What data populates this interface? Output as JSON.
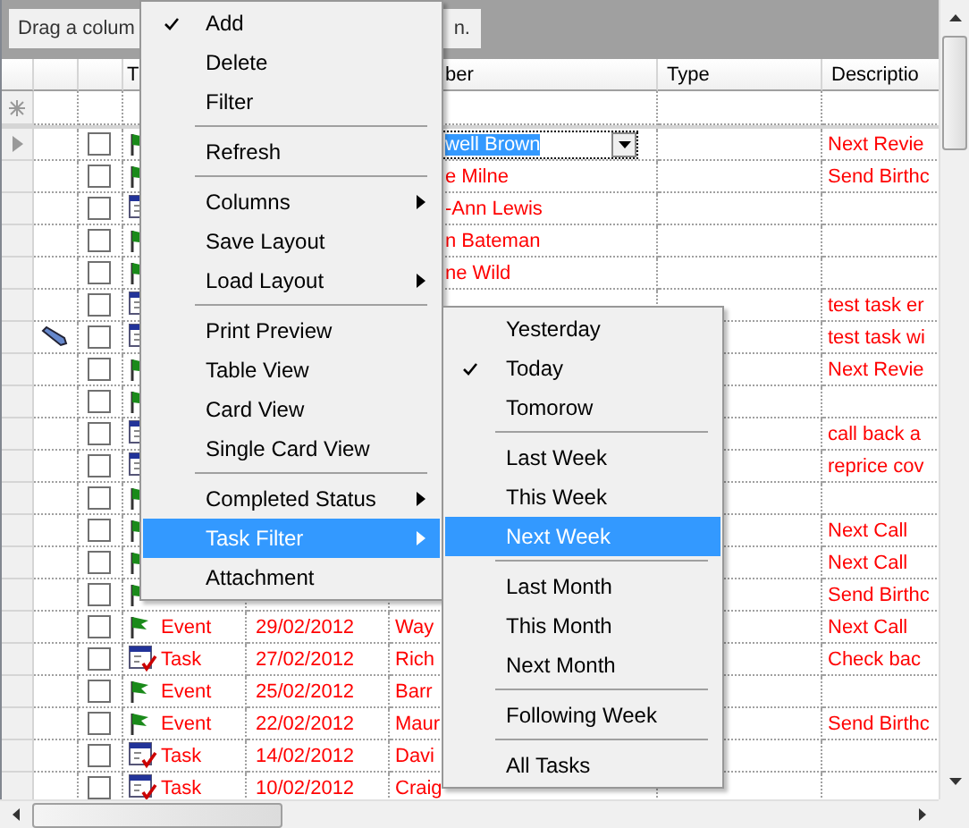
{
  "group_panel": {
    "text_left": "Drag a colum",
    "text_right": "n."
  },
  "columns": [
    {
      "label": "T"
    },
    {
      "label": "ber"
    },
    {
      "label": "Type"
    },
    {
      "label": "Descriptio"
    }
  ],
  "rows": [
    {
      "selected": true,
      "checked": false,
      "kind": "event",
      "attached": false,
      "name": "well Brown",
      "description": "Next Revie"
    },
    {
      "selected": false,
      "checked": false,
      "kind": "event",
      "attached": false,
      "name": "e Milne",
      "description": "Send Birthc"
    },
    {
      "selected": false,
      "checked": false,
      "kind": "task",
      "attached": false,
      "name": "-Ann Lewis"
    },
    {
      "selected": false,
      "checked": false,
      "kind": "event",
      "attached": false,
      "name": "n Bateman"
    },
    {
      "selected": false,
      "checked": false,
      "kind": "event",
      "attached": false,
      "name": "ne Wild"
    },
    {
      "selected": false,
      "checked": false,
      "kind": "task",
      "attached": false,
      "description": "test task er"
    },
    {
      "selected": false,
      "checked": false,
      "kind": "task",
      "attached": true,
      "description": "test task wi"
    },
    {
      "selected": false,
      "checked": false,
      "kind": "event",
      "attached": false,
      "description": "Next Revie"
    },
    {
      "selected": false,
      "checked": false,
      "kind": "event",
      "attached": false
    },
    {
      "selected": false,
      "checked": false,
      "kind": "task",
      "attached": false,
      "description": "call back a"
    },
    {
      "selected": false,
      "checked": false,
      "kind": "task",
      "attached": false,
      "description": "reprice cov"
    },
    {
      "selected": false,
      "checked": false,
      "kind": "event",
      "attached": false
    },
    {
      "selected": false,
      "checked": false,
      "kind": "event",
      "attached": false,
      "description": "Next Call"
    },
    {
      "selected": false,
      "checked": false,
      "kind": "event",
      "attached": false,
      "description": "Next Call"
    },
    {
      "selected": false,
      "checked": false,
      "kind": "event",
      "attached": false,
      "description": "Send Birthc"
    },
    {
      "selected": false,
      "checked": false,
      "kind": "event",
      "attached": false,
      "type": "Event",
      "date": "29/02/2012",
      "name": "Way",
      "description": "Next Call"
    },
    {
      "selected": false,
      "checked": false,
      "kind": "task",
      "attached": false,
      "type": "Task",
      "date": "27/02/2012",
      "name": "Rich",
      "description": "Check bac"
    },
    {
      "selected": false,
      "checked": false,
      "kind": "event",
      "attached": false,
      "type": "Event",
      "date": "25/02/2012",
      "name": "Barr"
    },
    {
      "selected": false,
      "checked": false,
      "kind": "event",
      "attached": false,
      "type": "Event",
      "date": "22/02/2012",
      "name": "Maur",
      "description": "Send Birthc"
    },
    {
      "selected": false,
      "checked": false,
      "kind": "task",
      "attached": false,
      "type": "Task",
      "date": "14/02/2012",
      "name": "Davi"
    },
    {
      "selected": false,
      "checked": false,
      "kind": "task",
      "attached": false,
      "type": "Task",
      "date": "10/02/2012",
      "name": "Craig"
    }
  ],
  "context_menu": [
    {
      "kind": "item",
      "label": "Add",
      "checked": true,
      "selected": false,
      "submenu": false
    },
    {
      "kind": "item",
      "label": "Delete",
      "checked": false,
      "selected": false,
      "submenu": false
    },
    {
      "kind": "item",
      "label": "Filter",
      "checked": false,
      "selected": false,
      "submenu": false
    },
    {
      "kind": "separator"
    },
    {
      "kind": "item",
      "label": "Refresh",
      "checked": false,
      "selected": false,
      "submenu": false
    },
    {
      "kind": "separator"
    },
    {
      "kind": "item",
      "label": "Columns",
      "checked": false,
      "selected": false,
      "submenu": true
    },
    {
      "kind": "item",
      "label": "Save Layout",
      "checked": false,
      "selected": false,
      "submenu": false
    },
    {
      "kind": "item",
      "label": "Load Layout",
      "checked": false,
      "selected": false,
      "submenu": true
    },
    {
      "kind": "separator"
    },
    {
      "kind": "item",
      "label": "Print Preview",
      "checked": false,
      "selected": false,
      "submenu": false
    },
    {
      "kind": "item",
      "label": "Table View",
      "checked": false,
      "selected": false,
      "submenu": false
    },
    {
      "kind": "item",
      "label": "Card View",
      "checked": false,
      "selected": false,
      "submenu": false
    },
    {
      "kind": "item",
      "label": "Single Card View",
      "checked": false,
      "selected": false,
      "submenu": false
    },
    {
      "kind": "separator"
    },
    {
      "kind": "item",
      "label": "Completed Status",
      "checked": false,
      "selected": false,
      "submenu": true
    },
    {
      "kind": "item",
      "label": "Task Filter",
      "checked": false,
      "selected": true,
      "submenu": true
    },
    {
      "kind": "item",
      "label": "Attachment",
      "checked": false,
      "selected": false,
      "submenu": false
    }
  ],
  "task_filter_menu": [
    {
      "kind": "item",
      "label": "Yesterday",
      "checked": false,
      "selected": false
    },
    {
      "kind": "item",
      "label": "Today",
      "checked": true,
      "selected": false
    },
    {
      "kind": "item",
      "label": "Tomorow",
      "checked": false,
      "selected": false
    },
    {
      "kind": "separator"
    },
    {
      "kind": "item",
      "label": "Last Week",
      "checked": false,
      "selected": false
    },
    {
      "kind": "item",
      "label": "This Week",
      "checked": false,
      "selected": false
    },
    {
      "kind": "item",
      "label": "Next Week",
      "checked": false,
      "selected": true
    },
    {
      "kind": "separator"
    },
    {
      "kind": "item",
      "label": "Last Month",
      "checked": false,
      "selected": false
    },
    {
      "kind": "item",
      "label": "This Month",
      "checked": false,
      "selected": false
    },
    {
      "kind": "item",
      "label": "Next Month",
      "checked": false,
      "selected": false
    },
    {
      "kind": "separator"
    },
    {
      "kind": "item",
      "label": "Following Week",
      "checked": false,
      "selected": false
    },
    {
      "kind": "separator"
    },
    {
      "kind": "item",
      "label": "All Tasks",
      "checked": false,
      "selected": false
    }
  ]
}
